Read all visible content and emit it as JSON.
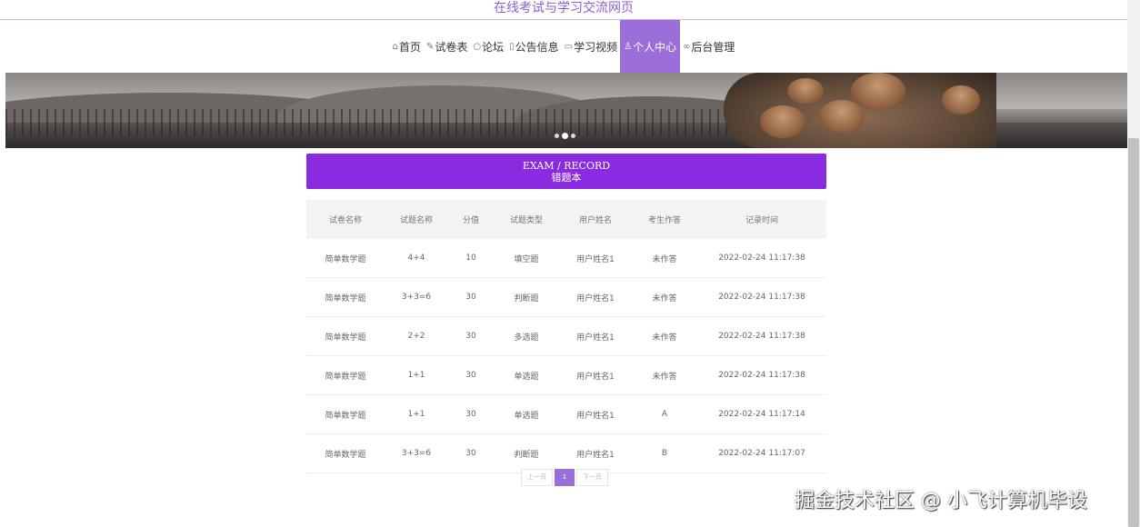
{
  "site": {
    "title": "在线考试与学习交流网页"
  },
  "nav": [
    {
      "icon": "home-icon",
      "glyph": "⌂",
      "label": "首页",
      "active": false
    },
    {
      "icon": "tag-icon",
      "glyph": "✎",
      "label": "试卷表",
      "active": false
    },
    {
      "icon": "chat-icon",
      "glyph": "○",
      "label": "论坛",
      "active": false
    },
    {
      "icon": "notice-icon",
      "glyph": "▯",
      "label": "公告信息",
      "active": false
    },
    {
      "icon": "video-icon",
      "glyph": "▭",
      "label": "学习视频",
      "active": false
    },
    {
      "icon": "user-icon",
      "glyph": "♙",
      "label": "个人中心",
      "active": true
    },
    {
      "icon": "link-icon",
      "glyph": "∞",
      "label": "后台管理",
      "active": false
    }
  ],
  "banner": {
    "dots": 3,
    "active_dot": 2
  },
  "section": {
    "en": "EXAM / RECORD",
    "zh": "错题本"
  },
  "table": {
    "headers": [
      "试卷名称",
      "试题名称",
      "分值",
      "试题类型",
      "用户姓名",
      "考生作答",
      "记录时间"
    ],
    "rows": [
      [
        "简单数学题",
        "4+4",
        "10",
        "填空题",
        "用户姓名1",
        "未作答",
        "2022-02-24 11:17:38"
      ],
      [
        "简单数学题",
        "3+3=6",
        "30",
        "判断题",
        "用户姓名1",
        "未作答",
        "2022-02-24 11:17:38"
      ],
      [
        "简单数学题",
        "2+2",
        "30",
        "多选题",
        "用户姓名1",
        "未作答",
        "2022-02-24 11:17:38"
      ],
      [
        "简单数学题",
        "1+1",
        "30",
        "单选题",
        "用户姓名1",
        "未作答",
        "2022-02-24 11:17:38"
      ],
      [
        "简单数学题",
        "1+1",
        "30",
        "单选题",
        "用户姓名1",
        "A",
        "2022-02-24 11:17:14"
      ],
      [
        "简单数学题",
        "3+3=6",
        "30",
        "判断题",
        "用户姓名1",
        "B",
        "2022-02-24 11:17:07"
      ]
    ]
  },
  "pagination": {
    "prev": "上一页",
    "current": "1",
    "next": "下一页"
  },
  "watermark": "掘金技术社区 @ 小飞计算机毕设",
  "colors": {
    "accent": "#9b6fd9",
    "header_bg": "#8a2be2",
    "title": "#8f5fd6"
  }
}
